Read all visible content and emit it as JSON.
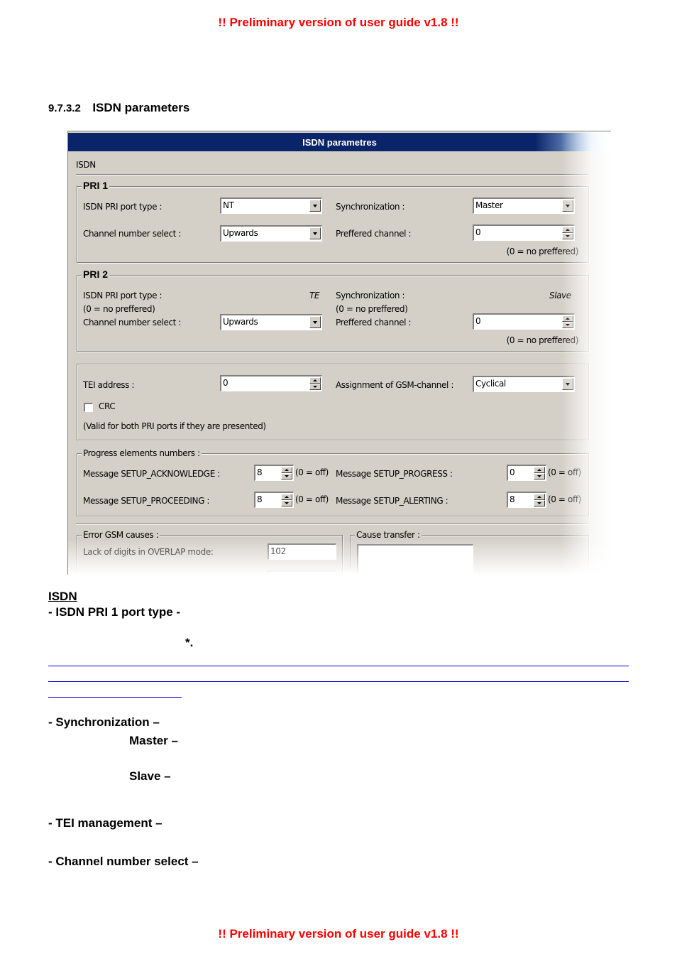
{
  "header_banner": "!! Preliminary version of user guide v1.8 !!",
  "footer_banner": "!! Preliminary version of user guide v1.8 !!",
  "section": {
    "number": "9.7.3.2",
    "title": "ISDN parameters"
  },
  "dialog": {
    "title": "ISDN parametres",
    "tab_label": "ISDN",
    "pri1": {
      "title": "PRI 1",
      "port_type_label": "ISDN PRI port type :",
      "port_type_value": "NT",
      "sync_label": "Synchronization :",
      "sync_value": "Master",
      "channel_select_label": "Channel number select  :",
      "channel_select_value": "Upwards",
      "preferred_channel_label": "Preffered channel :",
      "preferred_channel_value": "0",
      "preferred_hint": "(0 = no preffered)"
    },
    "pri2": {
      "title": "PRI 2",
      "port_type_label": "ISDN PRI port type :",
      "port_type_value": "TE",
      "port_hint": "(0 = no preffered)",
      "sync_label": "Synchronization :",
      "sync_value": "Slave",
      "sync_hint": "(0 = no preffered)",
      "channel_select_label": "Channel number select  :",
      "channel_select_value": "Upwards",
      "preferred_channel_label": "Preffered channel :",
      "preferred_channel_value": "0",
      "preferred_hint": "(0 = no preffered)"
    },
    "common": {
      "tei_label": "TEI address :",
      "tei_value": "0",
      "assignment_label": "Assignment of GSM-channel :",
      "assignment_value": "Cyclical",
      "crc_label": "CRC",
      "crc_checked": false,
      "note": "(Valid for both PRI ports if they are presented)"
    },
    "progress": {
      "title": "Progress elements numbers :",
      "off_hint": "(0 = off)",
      "setup_ack_label": "Message SETUP_ACKNOWLEDGE :",
      "setup_ack_value": "8",
      "setup_progress_label": "Message SETUP_PROGRESS :",
      "setup_progress_value": "0",
      "setup_proceeding_label": "Message SETUP_PROCEEDING :",
      "setup_proceeding_value": "8",
      "setup_alerting_label": "Message SETUP_ALERTING :",
      "setup_alerting_value": "8"
    },
    "error_causes": {
      "title": "Error GSM causes :",
      "overlap_label": "Lack of digits in OVERLAP mode:",
      "overlap_value": "102"
    },
    "cause_transfer": {
      "title": "Cause transfer :"
    }
  },
  "doc": {
    "isdn_heading": "ISDN",
    "pri1_port_heading": "- ISDN PRI 1 port type -",
    "asterisk": "*.",
    "sync_heading": "- Synchronization –",
    "master_heading": "Master –",
    "slave_heading": "Slave  –",
    "tei_heading": "- TEI management –",
    "channel_heading": "- Channel number select –"
  }
}
